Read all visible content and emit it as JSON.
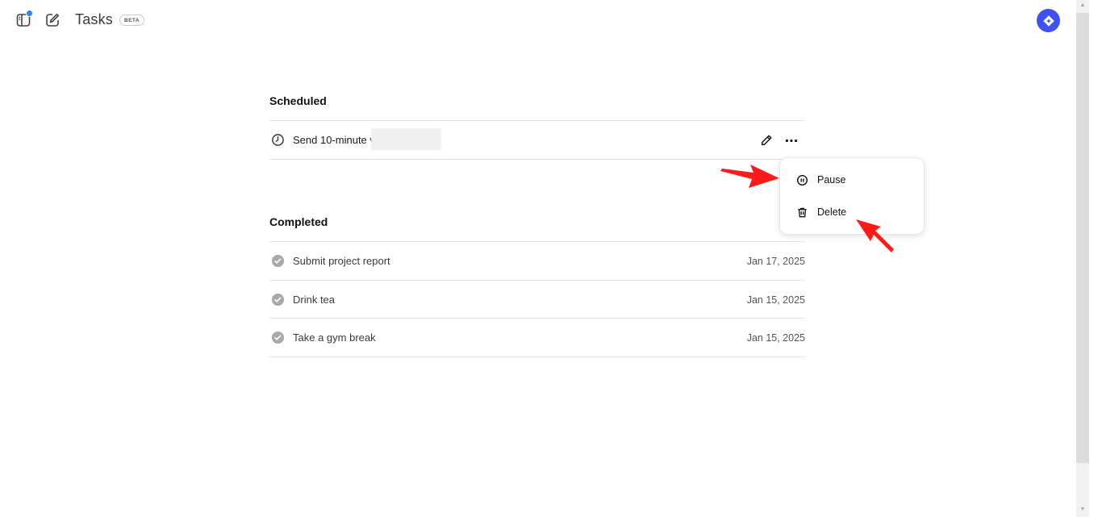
{
  "header": {
    "title": "Tasks",
    "badge": "BETA",
    "sidebar_icon": "sidebar-toggle-icon",
    "compose_icon": "new-chat-icon",
    "avatar_icon": "diamond-sparkle-icon"
  },
  "scheduled": {
    "title": "Scheduled",
    "items": [
      {
        "label": "Send 10-minute v",
        "icon": "clock-icon"
      }
    ]
  },
  "menu": {
    "items": [
      {
        "label": "Pause",
        "icon": "pause-circle-icon"
      },
      {
        "label": "Delete",
        "icon": "trash-icon"
      }
    ]
  },
  "completed": {
    "title": "Completed",
    "items": [
      {
        "label": "Submit project report",
        "date": "Jan 17, 2025",
        "icon": "check-circle-icon"
      },
      {
        "label": "Drink tea",
        "date": "Jan 15, 2025",
        "icon": "check-circle-icon"
      },
      {
        "label": "Take a gym break",
        "date": "Jan 15, 2025",
        "icon": "check-circle-icon"
      }
    ]
  },
  "colors": {
    "accent": "#3d52f0",
    "annotation_arrow": "#ff0000",
    "notification_dot": "#1e88ff"
  }
}
